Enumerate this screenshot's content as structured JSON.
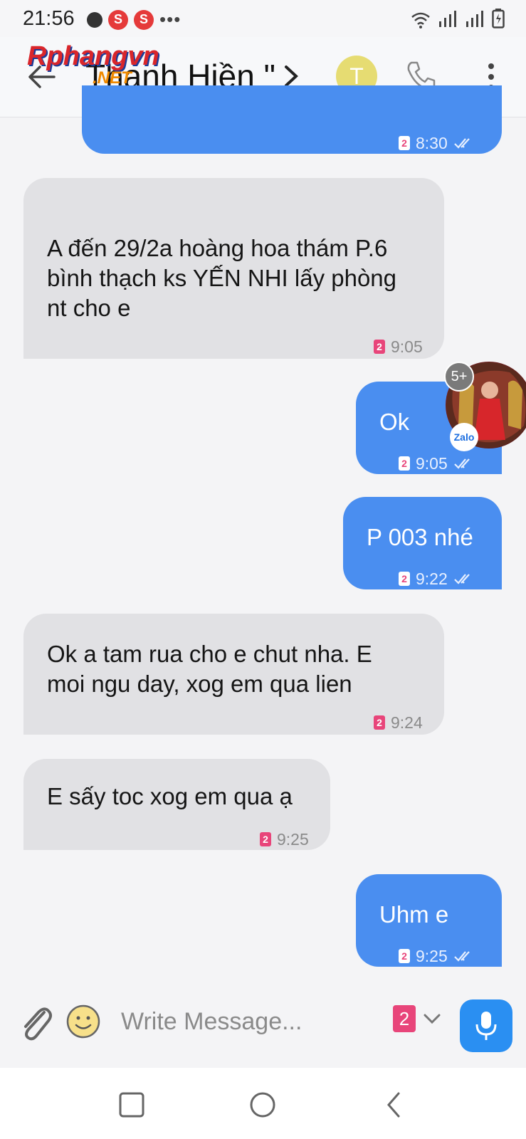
{
  "status_bar": {
    "time": "21:56",
    "notification_badges": [
      "S",
      "S"
    ],
    "more": "•••"
  },
  "header": {
    "title": "Thạnh Hiền \"",
    "watermark": "Rphangvn",
    "watermark_sub": ".NET",
    "avatar_letter": "T"
  },
  "messages": [
    {
      "dir": "out",
      "text": "",
      "sim": "2",
      "time": "8:30"
    },
    {
      "dir": "in",
      "lines": [
        "A đến 29/2a hoàng hoa thám P.6",
        "bình thạch ks YẾN NHI lấy phòng",
        "nt cho e"
      ],
      "sim": "2",
      "time": "9:05"
    },
    {
      "dir": "out",
      "text": "Ok",
      "sim": "2",
      "time": "9:05"
    },
    {
      "dir": "out",
      "text": "P 003 nhé",
      "sim": "2",
      "time": "9:22"
    },
    {
      "dir": "in",
      "lines": [
        "Ok a tam rua cho e chut nha. E",
        "moi ngu day, xog em qua lien"
      ],
      "sim": "2",
      "time": "9:24"
    },
    {
      "dir": "in",
      "lines": [
        "E sấy toc xog em qua ạ"
      ],
      "sim": "2",
      "time": "9:25"
    },
    {
      "dir": "out",
      "text": "Uhm e",
      "sim": "2",
      "time": "9:25"
    }
  ],
  "chathead": {
    "count": "5+",
    "app": "Zalo"
  },
  "composer": {
    "placeholder": "Write Message...",
    "sim": "2"
  },
  "colors": {
    "outgoing_bubble": "#4a8ef0",
    "incoming_bubble": "#e1e1e4",
    "sim_badge": "#e8457a",
    "mic_button": "#2a8ff2",
    "avatar": "#e6dc72"
  }
}
